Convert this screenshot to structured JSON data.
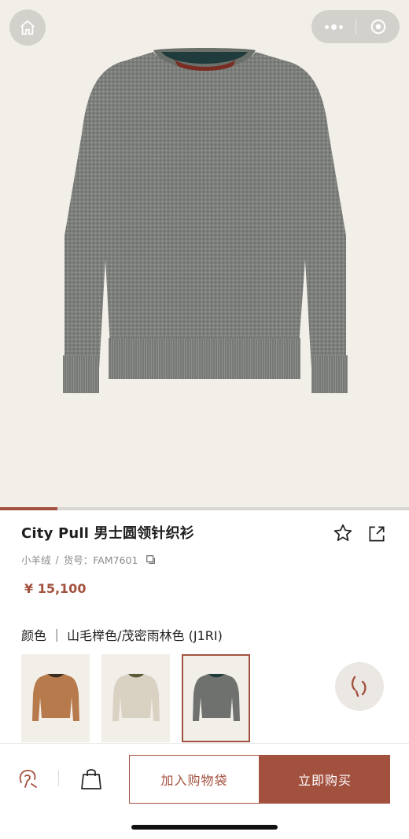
{
  "product": {
    "title": "City Pull 男士圆领针织衫",
    "material": "小羊绒",
    "sku_label": "货号：FAM7601",
    "meta_separator": "/",
    "price": "¥ 15,100",
    "color_line": "颜色 ｜ 山毛榉色/茂密雨林色 (J1RI)",
    "image_progress": 0.14
  },
  "swatches": [
    {
      "name": "orange-sweater",
      "color": "#b77a4c"
    },
    {
      "name": "cream-sweater",
      "color": "#d9d2c3"
    },
    {
      "name": "grey-sweater",
      "color": "#6e716d",
      "selected": true
    }
  ],
  "actions": {
    "add_to_bag": "加入购物袋",
    "buy_now": "立即购买"
  },
  "colors": {
    "accent": "#a3513f",
    "hero_bg": "#f2efe9",
    "sweater_main": "#7b7e7a"
  },
  "icons": [
    "home-icon",
    "more-icon",
    "target-icon",
    "star-icon",
    "share-icon",
    "copy-icon",
    "chat-icon",
    "assistant-icon",
    "bag-icon"
  ]
}
